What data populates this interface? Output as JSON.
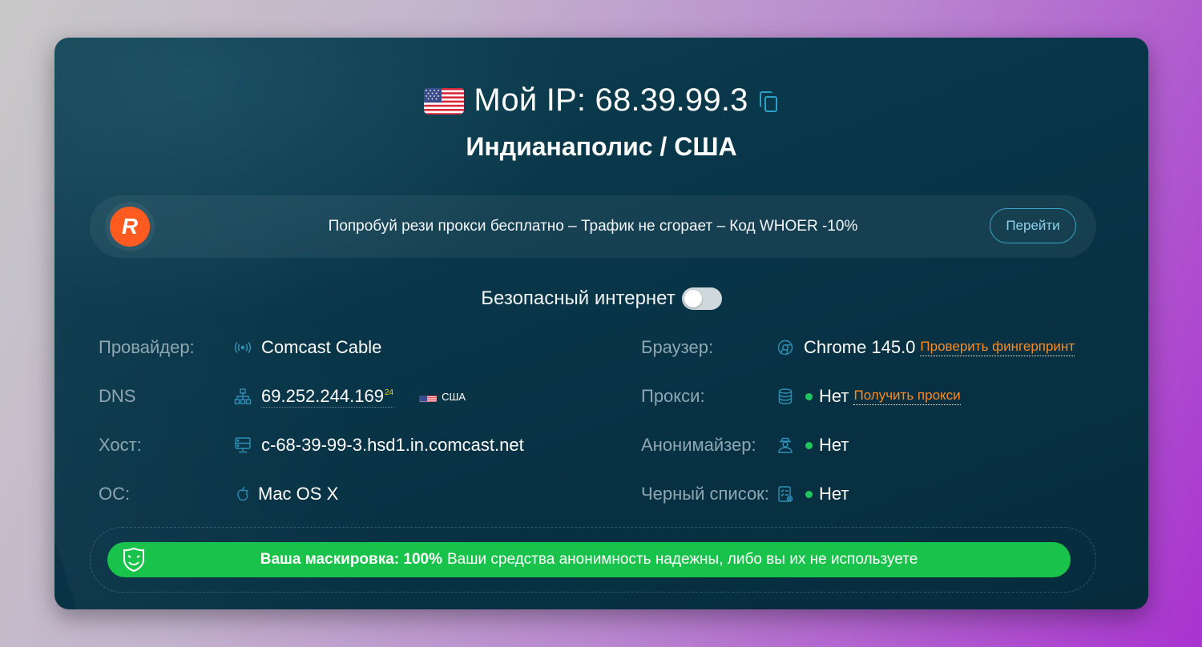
{
  "header": {
    "ip_label": "Мой IP: 68.39.99.3",
    "location": "Индианаполис / США",
    "flag_icon": "us-flag-icon",
    "copy_icon": "copy-icon"
  },
  "promo": {
    "text": "Попробуй рези прокси бесплатно – Трафик не сгорает – Код WHOER -10%",
    "button_label": "Перейти",
    "logo_letter": "R",
    "logo_color": "#ff5a1f"
  },
  "safe_internet": {
    "label": "Безопасный интернет",
    "enabled": false
  },
  "info": {
    "provider": {
      "label": "Провайдер:",
      "value": "Comcast Cable",
      "icon": "antenna-icon"
    },
    "dns": {
      "label": "DNS",
      "value": "69.252.244.169",
      "sup": "24",
      "country": "США",
      "icon": "network-icon"
    },
    "host": {
      "label": "Хост:",
      "value": "c-68-39-99-3.hsd1.in.comcast.net",
      "icon": "server-icon"
    },
    "os": {
      "label": "ОС:",
      "value": "Mac OS X",
      "icon": "apple-icon"
    },
    "browser": {
      "label": "Браузер:",
      "value": "Chrome 145.0",
      "link": "Проверить фингерпринт",
      "icon": "chrome-icon"
    },
    "proxy": {
      "label": "Прокси:",
      "value": "Нет",
      "link": "Получить прокси",
      "icon": "database-icon"
    },
    "anonymizer": {
      "label": "Анонимайзер:",
      "value": "Нет",
      "icon": "user-incognito-icon"
    },
    "blacklist": {
      "label": "Черный список:",
      "value": "Нет",
      "icon": "checklist-icon"
    }
  },
  "status": {
    "bold": "Ваша маскировка: 100%",
    "text": "Ваши средства анонимность надежны, либо вы их не используете",
    "icon": "mask-icon",
    "color": "#19c24b"
  },
  "colors": {
    "card_bg": "#083548",
    "accent_blue": "#2fa0c4",
    "link_orange": "#ff8a1f",
    "ok_green": "#21c55d"
  }
}
